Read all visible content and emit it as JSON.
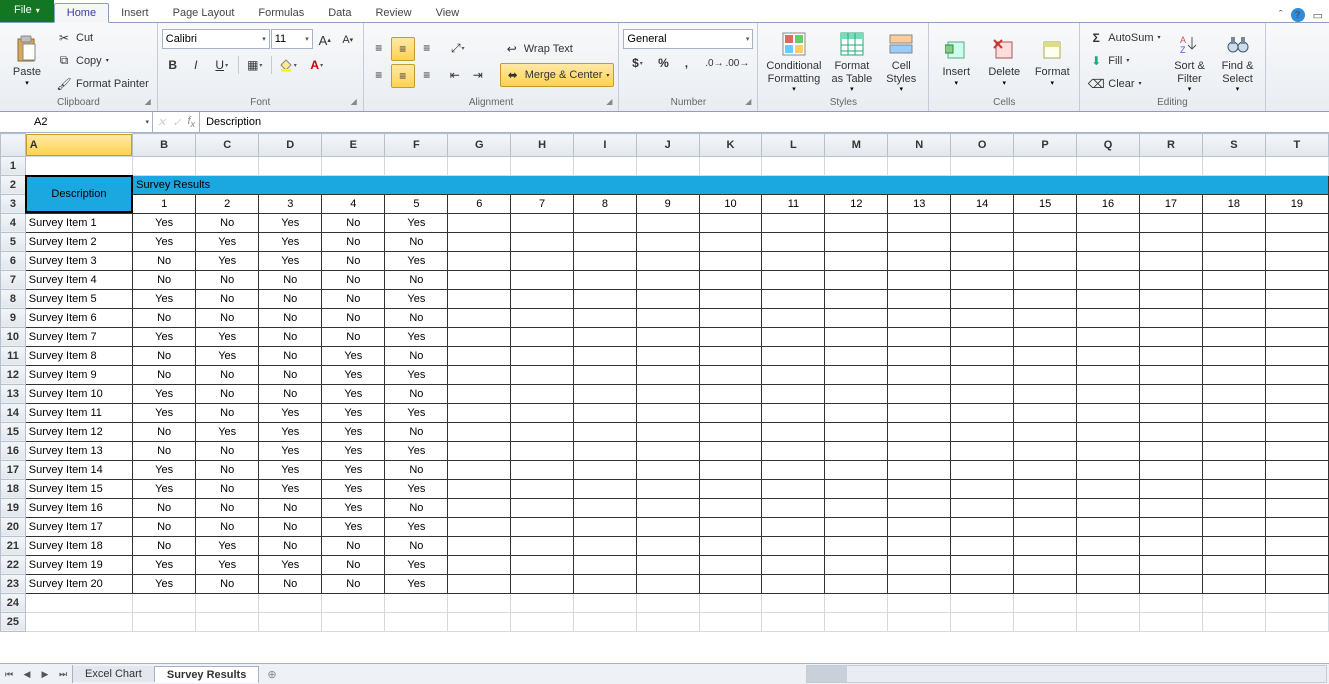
{
  "tabs": {
    "file": "File",
    "home": "Home",
    "insert": "Insert",
    "page_layout": "Page Layout",
    "formulas": "Formulas",
    "data": "Data",
    "review": "Review",
    "view": "View"
  },
  "clipboard": {
    "paste": "Paste",
    "cut": "Cut",
    "copy": "Copy",
    "format_painter": "Format Painter",
    "label": "Clipboard"
  },
  "font": {
    "name": "Calibri",
    "size": "11",
    "label": "Font"
  },
  "alignment": {
    "wrap": "Wrap Text",
    "merge": "Merge & Center",
    "label": "Alignment"
  },
  "number": {
    "format": "General",
    "label": "Number"
  },
  "styles": {
    "cond": "Conditional\nFormatting",
    "table": "Format\nas Table",
    "cell": "Cell\nStyles",
    "label": "Styles"
  },
  "cells": {
    "insert": "Insert",
    "delete": "Delete",
    "format": "Format",
    "label": "Cells"
  },
  "editing": {
    "autosum": "AutoSum",
    "fill": "Fill",
    "clear": "Clear",
    "sort": "Sort &\nFilter",
    "find": "Find &\nSelect",
    "label": "Editing"
  },
  "namebox": "A2",
  "formula": "Description",
  "columns": [
    "A",
    "B",
    "C",
    "D",
    "E",
    "F",
    "G",
    "H",
    "I",
    "J",
    "K",
    "L",
    "M",
    "N",
    "O",
    "P",
    "Q",
    "R",
    "S",
    "T"
  ],
  "header_title": "Survey Results",
  "desc_label": "Description",
  "num_headers": [
    "1",
    "2",
    "3",
    "4",
    "5",
    "6",
    "7",
    "8",
    "9",
    "10",
    "11",
    "12",
    "13",
    "14",
    "15",
    "16",
    "17",
    "18",
    "19"
  ],
  "rows": [
    {
      "n": "4",
      "d": "Survey Item 1",
      "v": [
        "Yes",
        "No",
        "Yes",
        "No",
        "Yes"
      ]
    },
    {
      "n": "5",
      "d": "Survey Item 2",
      "v": [
        "Yes",
        "Yes",
        "Yes",
        "No",
        "No"
      ]
    },
    {
      "n": "6",
      "d": "Survey Item 3",
      "v": [
        "No",
        "Yes",
        "Yes",
        "No",
        "Yes"
      ]
    },
    {
      "n": "7",
      "d": "Survey Item 4",
      "v": [
        "No",
        "No",
        "No",
        "No",
        "No"
      ]
    },
    {
      "n": "8",
      "d": "Survey Item 5",
      "v": [
        "Yes",
        "No",
        "No",
        "No",
        "Yes"
      ]
    },
    {
      "n": "9",
      "d": "Survey Item 6",
      "v": [
        "No",
        "No",
        "No",
        "No",
        "No"
      ]
    },
    {
      "n": "10",
      "d": "Survey Item 7",
      "v": [
        "Yes",
        "Yes",
        "No",
        "No",
        "Yes"
      ]
    },
    {
      "n": "11",
      "d": "Survey Item 8",
      "v": [
        "No",
        "Yes",
        "No",
        "Yes",
        "No"
      ]
    },
    {
      "n": "12",
      "d": "Survey Item 9",
      "v": [
        "No",
        "No",
        "No",
        "Yes",
        "Yes"
      ]
    },
    {
      "n": "13",
      "d": "Survey Item 10",
      "v": [
        "Yes",
        "No",
        "No",
        "Yes",
        "No"
      ]
    },
    {
      "n": "14",
      "d": "Survey Item 11",
      "v": [
        "Yes",
        "No",
        "Yes",
        "Yes",
        "Yes"
      ]
    },
    {
      "n": "15",
      "d": "Survey Item 12",
      "v": [
        "No",
        "Yes",
        "Yes",
        "Yes",
        "No"
      ]
    },
    {
      "n": "16",
      "d": "Survey Item 13",
      "v": [
        "No",
        "No",
        "Yes",
        "Yes",
        "Yes"
      ]
    },
    {
      "n": "17",
      "d": "Survey Item 14",
      "v": [
        "Yes",
        "No",
        "Yes",
        "Yes",
        "No"
      ]
    },
    {
      "n": "18",
      "d": "Survey Item 15",
      "v": [
        "Yes",
        "No",
        "Yes",
        "Yes",
        "Yes"
      ]
    },
    {
      "n": "19",
      "d": "Survey Item 16",
      "v": [
        "No",
        "No",
        "No",
        "Yes",
        "No"
      ]
    },
    {
      "n": "20",
      "d": "Survey Item 17",
      "v": [
        "No",
        "No",
        "No",
        "Yes",
        "Yes"
      ]
    },
    {
      "n": "21",
      "d": "Survey Item 18",
      "v": [
        "No",
        "Yes",
        "No",
        "No",
        "No"
      ]
    },
    {
      "n": "22",
      "d": "Survey Item 19",
      "v": [
        "Yes",
        "Yes",
        "Yes",
        "No",
        "Yes"
      ]
    },
    {
      "n": "23",
      "d": "Survey Item 20",
      "v": [
        "Yes",
        "No",
        "No",
        "No",
        "Yes"
      ]
    }
  ],
  "emptyrows": [
    "24",
    "25"
  ],
  "sheets": {
    "s1": "Excel Chart",
    "s2": "Survey Results"
  }
}
